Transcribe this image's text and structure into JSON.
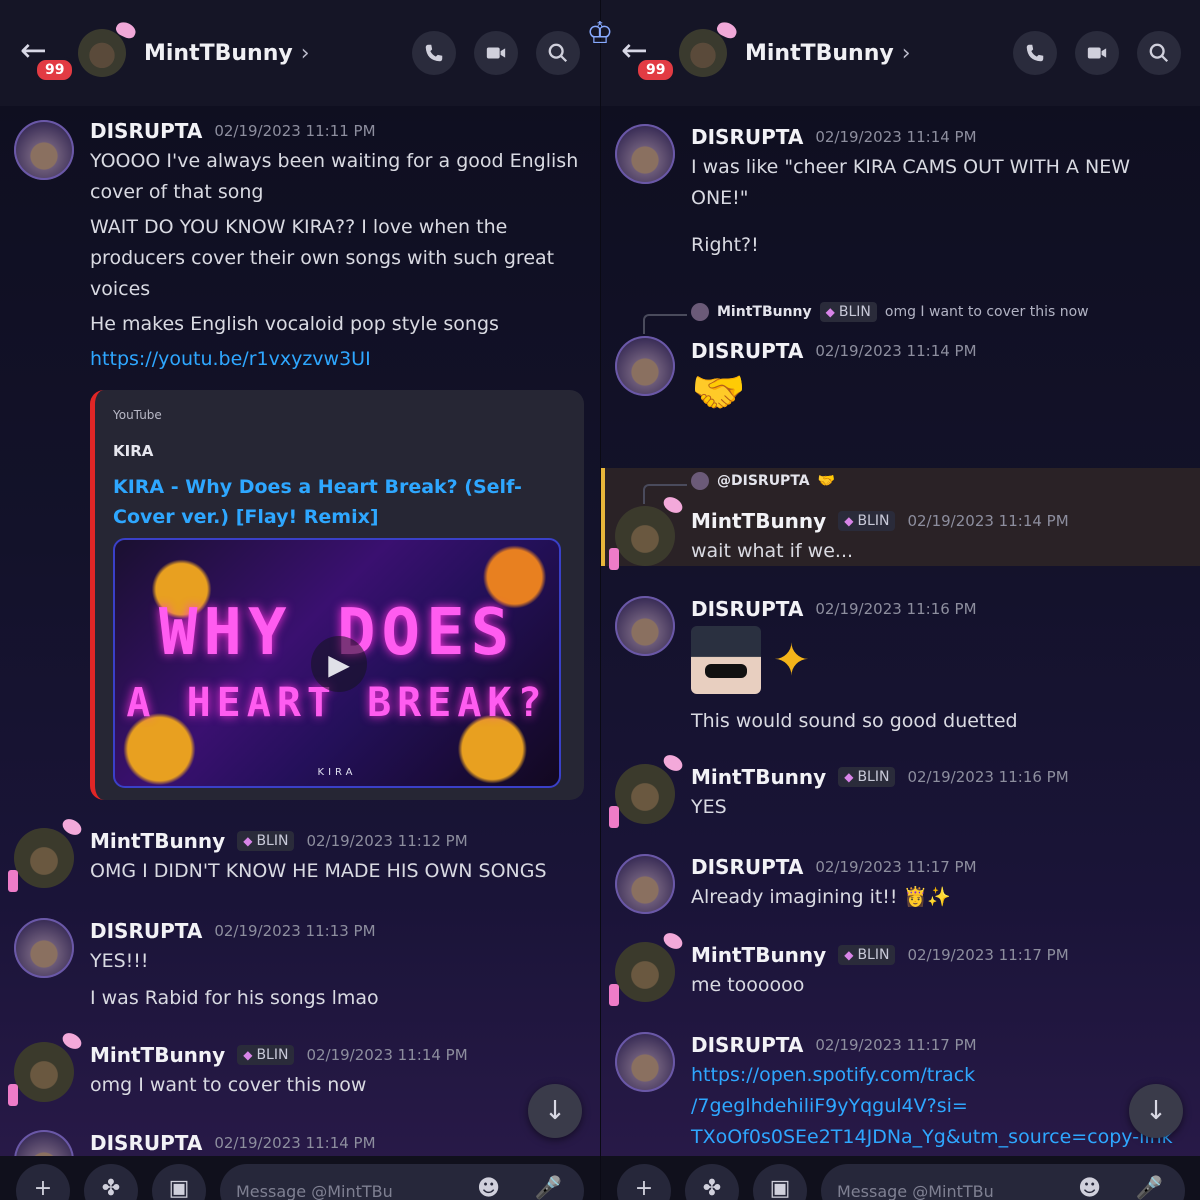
{
  "header": {
    "title": "MintTBunny",
    "badge": "99",
    "back_icon": "←",
    "chevron": "›"
  },
  "icons": {
    "call": "call-icon",
    "video": "video-icon",
    "search": "search-icon"
  },
  "left_messages": [
    {
      "author": "DISRUPTA",
      "time": "02/19/2023 11:11 PM",
      "lines": [
        "YOOOO I've always been waiting for a good English cover of that song",
        "WAIT DO YOU KNOW KIRA?? I love when the producers cover their own songs with such great voices",
        "He makes English vocaloid pop style songs"
      ],
      "link": "https://youtu.be/r1vxyzvw3UI"
    },
    {
      "author": "MintTBunny",
      "tag": "BLIN",
      "time": "02/19/2023 11:12 PM",
      "text": "OMG I DIDN'T KNOW HE MADE HIS OWN SONGS"
    },
    {
      "author": "DISRUPTA",
      "time": "02/19/2023 11:13 PM",
      "lines": [
        "YES!!!",
        "I was Rabid for his songs lmao"
      ]
    },
    {
      "author": "MintTBunny",
      "tag": "BLIN",
      "time": "02/19/2023 11:14 PM",
      "text": "omg I want to cover this now"
    },
    {
      "author": "DISRUPTA",
      "time": "02/19/2023 11:14 PM"
    }
  ],
  "embed": {
    "provider": "YouTube",
    "author": "KIRA",
    "title": "KIRA - Why Does a Heart Break? (Self-Cover ver.) [Flay! Remix]",
    "thumb_line1": "WHY DOES",
    "thumb_line2": "A HEART BREAK?",
    "thumb_line3": "KIRA"
  },
  "right_messages": [
    {
      "author": "DISRUPTA",
      "time": "02/19/2023 11:14 PM",
      "lines": [
        "I was like \"cheer KIRA CAMS OUT WITH A NEW ONE!\"",
        "Right?!"
      ]
    },
    {
      "reply_author": "MintTBunny",
      "reply_tag": "BLIN",
      "reply_text": "omg I want to cover this now",
      "author": "DISRUPTA",
      "time": "02/19/2023 11:14 PM",
      "emoji": "🤝"
    },
    {
      "reply_author": "@DISRUPTA",
      "reply_emoji": "🤝",
      "author": "MintTBunny",
      "tag": "BLIN",
      "time": "02/19/2023 11:14 PM",
      "text": "wait what if we..."
    },
    {
      "author": "DISRUPTA",
      "time": "02/19/2023 11:16 PM",
      "sparkle": "✦",
      "text": "This would sound so good duetted"
    },
    {
      "author": "MintTBunny",
      "tag": "BLIN",
      "time": "02/19/2023 11:16 PM",
      "text": "YES"
    },
    {
      "author": "DISRUPTA",
      "time": "02/19/2023 11:17 PM",
      "text": "Already imagining it!! 👸✨"
    },
    {
      "author": "MintTBunny",
      "tag": "BLIN",
      "time": "02/19/2023 11:17 PM",
      "text": "me toooooo"
    },
    {
      "author": "DISRUPTA",
      "time": "02/19/2023 11:17 PM",
      "link_lines": [
        "https://open.spotify.com/track",
        "/7geglhdehiliF9yYqgul4V?si=",
        "TXoOf0s0SEe2T14JDNa_Yg&utm_source=copy-link"
      ]
    }
  ],
  "footer": {
    "placeholder": "Message @MintTBu"
  },
  "colors": {
    "link": "#2ea7ff",
    "badge": "#e23b43",
    "highlight_bar": "#e7b63a"
  }
}
